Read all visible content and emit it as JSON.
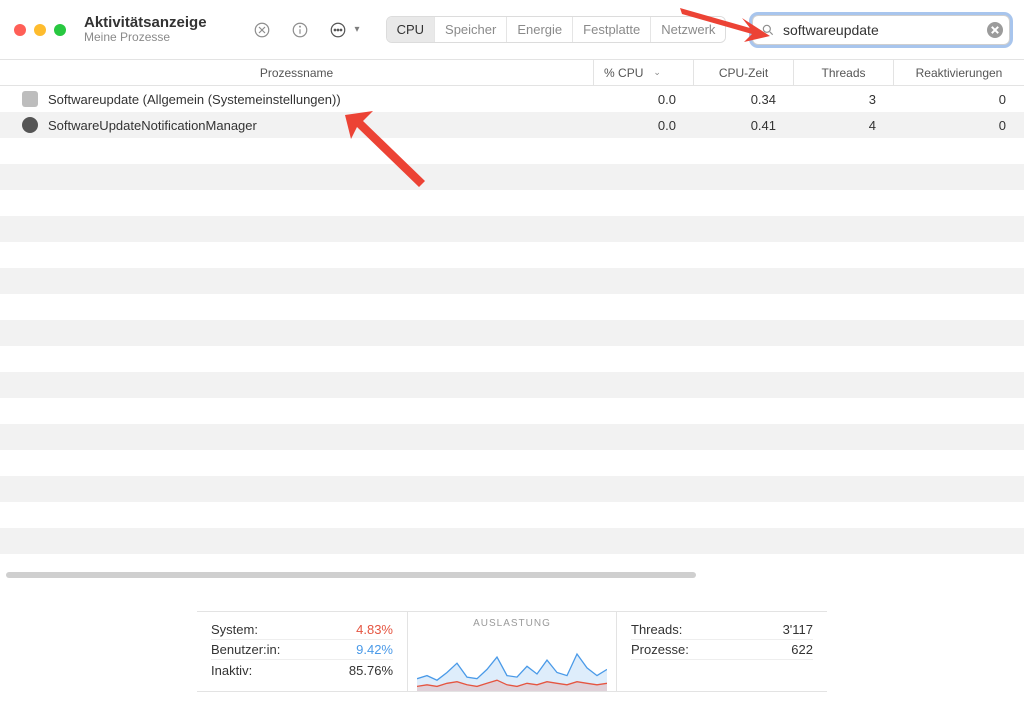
{
  "window": {
    "title": "Aktivitätsanzeige",
    "subtitle": "Meine Prozesse"
  },
  "tabs": {
    "items": [
      "CPU",
      "Speicher",
      "Energie",
      "Festplatte",
      "Netzwerk"
    ],
    "active_index": 0
  },
  "search": {
    "value": "softwareupdate"
  },
  "columns": {
    "name": "Prozessname",
    "cpu": "% CPU",
    "time": "CPU-Zeit",
    "threads": "Threads",
    "react": "Reaktivierungen"
  },
  "processes": [
    {
      "icon": "light",
      "name": "Softwareupdate (Allgemein (Systemeinstellungen))",
      "cpu": "0.0",
      "time": "0.34",
      "threads": "3",
      "react": "0"
    },
    {
      "icon": "dark",
      "name": "SoftwareUpdateNotificationManager",
      "cpu": "0.0",
      "time": "0.41",
      "threads": "4",
      "react": "0"
    }
  ],
  "footer": {
    "load_title": "AUSLASTUNG",
    "left": [
      {
        "label": "System:",
        "value": "4.83%",
        "cls": "val-red"
      },
      {
        "label": "Benutzer:in:",
        "value": "9.42%",
        "cls": "val-blue"
      },
      {
        "label": "Inaktiv:",
        "value": "85.76%",
        "cls": ""
      }
    ],
    "right": [
      {
        "label": "Threads:",
        "value": "3'117"
      },
      {
        "label": "Prozesse:",
        "value": "622"
      }
    ]
  },
  "chart_data": {
    "type": "area",
    "title": "AUSLASTUNG",
    "ylim": [
      0,
      100
    ],
    "x": [
      0,
      1,
      2,
      3,
      4,
      5,
      6,
      7,
      8,
      9,
      10,
      11,
      12,
      13,
      14,
      15,
      16,
      17,
      18,
      19
    ],
    "series": [
      {
        "name": "System",
        "color": "#e55541",
        "values": [
          3,
          4,
          3,
          5,
          6,
          4,
          3,
          5,
          7,
          4,
          3,
          5,
          4,
          6,
          5,
          4,
          6,
          5,
          4,
          5
        ]
      },
      {
        "name": "Benutzer:in",
        "color": "#4a9ae8",
        "values": [
          8,
          10,
          7,
          12,
          18,
          9,
          8,
          14,
          22,
          10,
          9,
          16,
          11,
          20,
          12,
          10,
          24,
          15,
          10,
          14
        ]
      }
    ]
  }
}
